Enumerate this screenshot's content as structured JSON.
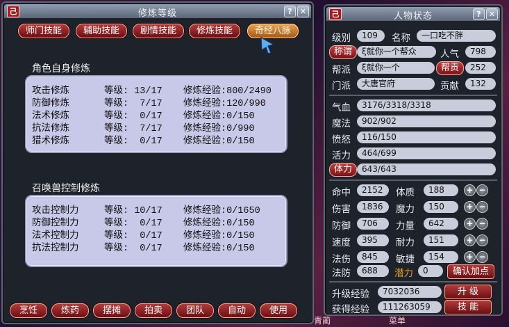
{
  "skills_window": {
    "title": "修炼等级",
    "tabs": [
      "师门技能",
      "辅助技能",
      "剧情技能",
      "修炼技能",
      "奇经八脉"
    ],
    "self_section": {
      "title": "角色自身修炼",
      "rows": [
        {
          "name": "攻击修炼",
          "level": "等级: 13/17",
          "exp": "修炼经验:800/2490"
        },
        {
          "name": "防御修炼",
          "level": "等级:  7/17",
          "exp": "修炼经验:120/990"
        },
        {
          "name": "法术修炼",
          "level": "等级:  0/17",
          "exp": "修炼经验:0/150"
        },
        {
          "name": "抗法修炼",
          "level": "等级:  7/17",
          "exp": "修炼经验:0/990"
        },
        {
          "name": "猎术修炼",
          "level": "等级:  0/17",
          "exp": "修炼经验:0/150"
        }
      ]
    },
    "pet_section": {
      "title": "召唤兽控制修炼",
      "rows": [
        {
          "name": "攻击控制力",
          "level": "等级: 10/17",
          "exp": "修炼经验:0/1650"
        },
        {
          "name": "防御控制力",
          "level": "等级:  0/17",
          "exp": "修炼经验:0/150"
        },
        {
          "name": "法术控制力",
          "level": "等级:  0/17",
          "exp": "修炼经验:0/150"
        },
        {
          "name": "抗法控制力",
          "level": "等级:  0/17",
          "exp": "修炼经验:0/150"
        }
      ]
    },
    "bottom_buttons": [
      "烹饪",
      "炼药",
      "摆摊",
      "拍卖",
      "团队",
      "自动",
      "使用"
    ]
  },
  "status_window": {
    "title": "人物状态",
    "level_label": "级别",
    "level": "109",
    "name_label": "名称",
    "name": "一口吃不胖",
    "title_btn": "称谓",
    "title_value": "ξ就你一个帮众",
    "popularity_label": "人气",
    "popularity": "798",
    "faction_label": "帮派",
    "faction": "ξ就你一个",
    "contrib_btn": "帮贡",
    "contrib": "252",
    "school_label": "门派",
    "school": "大唐官府",
    "devotion_label": "贡献",
    "devotion": "132",
    "hp_label": "气血",
    "hp": "3176/3318/3318",
    "mp_label": "魔法",
    "mp": "902/902",
    "anger_label": "愤怒",
    "anger": "116/150",
    "vitality_label": "活力",
    "vitality": "464/699",
    "stamina_btn": "体力",
    "stamina": "643/643",
    "attrs_left": [
      {
        "label": "命中",
        "value": "2152"
      },
      {
        "label": "伤害",
        "value": "1836"
      },
      {
        "label": "防御",
        "value": "706"
      },
      {
        "label": "速度",
        "value": "395"
      },
      {
        "label": "法伤",
        "value": "845"
      },
      {
        "label": "法防",
        "value": "688"
      }
    ],
    "attrs_right": [
      {
        "label": "体质",
        "value": "188"
      },
      {
        "label": "魔力",
        "value": "150"
      },
      {
        "label": "力量",
        "value": "642"
      },
      {
        "label": "耐力",
        "value": "151"
      },
      {
        "label": "敏捷",
        "value": "154"
      }
    ],
    "potential_label": "潜力",
    "potential": "0",
    "confirm_btn": "确认加点",
    "upgrade_exp_label": "升级经验",
    "upgrade_exp": "7032036",
    "upgrade_btn": "升 级",
    "gained_exp_label": "获得经验",
    "gained_exp": "111263059",
    "skill_btn": "技 能"
  },
  "background_text": {
    "left": "青蔺",
    "right": "菜单"
  },
  "colors": {
    "tab_active": "#e6a050",
    "button_red": "#8a1c20",
    "panel": "#c8c8e8",
    "potential_label": "#e8a020"
  }
}
